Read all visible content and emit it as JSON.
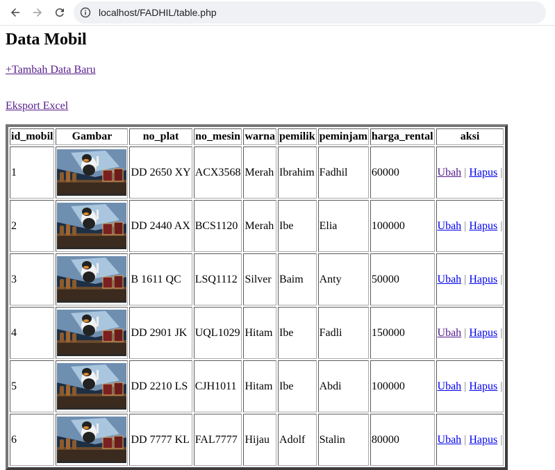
{
  "browser": {
    "url": "localhost/FADHIL/table.php"
  },
  "page": {
    "title": "Data Mobil",
    "add_link": "+Tambah Data Baru",
    "export_link": "Eksport Excel"
  },
  "table": {
    "headers": [
      "id_mobil",
      "Gambar",
      "no_plat",
      "no_mesin",
      "warna",
      "pemilik",
      "peminjam",
      "harga_rental",
      "aksi"
    ],
    "edit_label": "Ubah",
    "delete_label": "Hapus",
    "separator": "|",
    "rows": [
      {
        "id": "1",
        "no_plat": "DD 2650 XY",
        "no_mesin": "ACX3568",
        "warna": "Merah",
        "pemilik": "Ibrahim",
        "peminjam": "Fadhil",
        "harga": "60000",
        "edit_visited": true
      },
      {
        "id": "2",
        "no_plat": "DD 2440 AX",
        "no_mesin": "BCS1120",
        "warna": "Merah",
        "pemilik": "Ibe",
        "peminjam": "Elia",
        "harga": "100000",
        "edit_visited": false
      },
      {
        "id": "3",
        "no_plat": "B 1611 QC",
        "no_mesin": "LSQ1112",
        "warna": "Silver",
        "pemilik": "Baim",
        "peminjam": "Anty",
        "harga": "50000",
        "edit_visited": false
      },
      {
        "id": "4",
        "no_plat": "DD 2901 JK",
        "no_mesin": "UQL1029",
        "warna": "Hitam",
        "pemilik": "Ibe",
        "peminjam": "Fadli",
        "harga": "150000",
        "edit_visited": true
      },
      {
        "id": "5",
        "no_plat": "DD 2210 LS",
        "no_mesin": "CJH1011",
        "warna": "Hitam",
        "pemilik": "Ibe",
        "peminjam": "Abdi",
        "harga": "100000",
        "edit_visited": false
      },
      {
        "id": "6",
        "no_plat": "DD 7777 KL",
        "no_mesin": "FAL7777",
        "warna": "Hijau",
        "pemilik": "Adolf",
        "peminjam": "Stalin",
        "harga": "80000",
        "edit_visited": false
      }
    ]
  },
  "icons": {
    "back": "back-arrow-icon",
    "forward": "forward-arrow-icon",
    "reload": "reload-icon",
    "info": "info-icon"
  }
}
